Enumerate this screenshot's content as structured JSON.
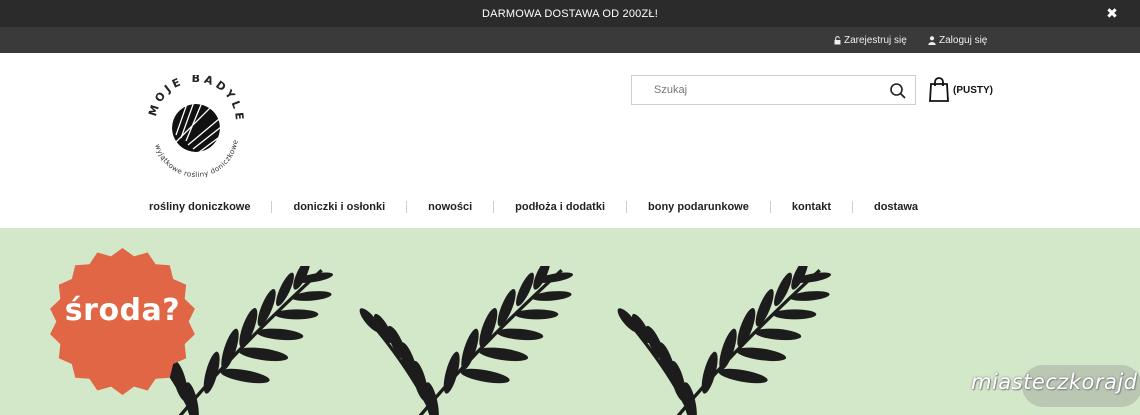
{
  "promo": {
    "text": "DARMOWA DOSTAWA OD 200ZŁ!",
    "close_icon": "✖"
  },
  "userbar": {
    "register": "Zarejestruj się",
    "login": "Zaloguj się"
  },
  "logo": {
    "arc_text": "MOJE BADYLE",
    "sub_text": "wyjątkowe rośliny doniczkowe"
  },
  "search": {
    "placeholder": "Szukaj"
  },
  "cart": {
    "label": "(PUSTY)"
  },
  "nav": {
    "items": [
      "rośliny doniczkowe",
      "doniczki i osłonki",
      "nowości",
      "podłoża i dodatki",
      "bony podarunkowe",
      "kontakt",
      "dostawa"
    ]
  },
  "hero": {
    "badge_text": "środa?",
    "watermark": "miasteczkorajd"
  },
  "colors": {
    "topbar": "#2b2b2b",
    "userbar": "#3a3a3a",
    "hero_bg": "#d3e7c9",
    "badge": "#e06645",
    "fern": "#1c1c1c"
  }
}
